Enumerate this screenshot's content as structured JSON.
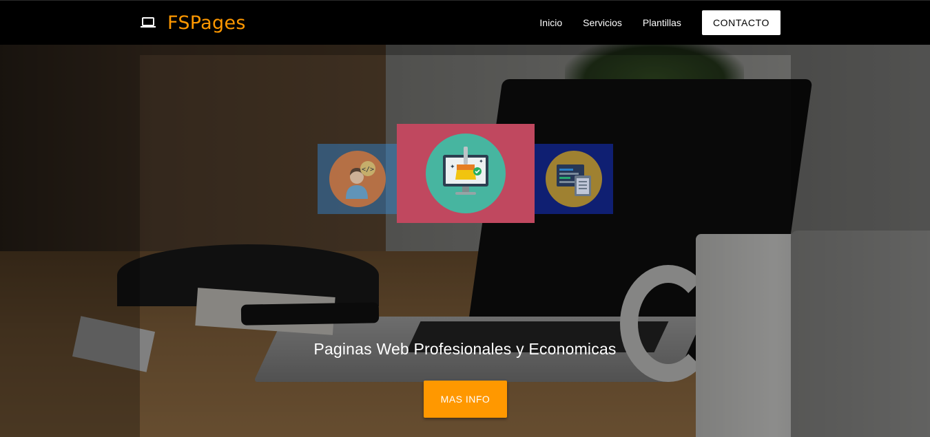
{
  "navbar": {
    "brand_icon": "laptop-icon",
    "brand_name": "FSPages",
    "links": [
      {
        "label": "Inicio"
      },
      {
        "label": "Servicios"
      },
      {
        "label": "Plantillas"
      }
    ],
    "cta_label": "CONTACTO"
  },
  "hero": {
    "title": "Paginas Web Profesionales y Economicas",
    "button_label": "MAS INFO",
    "carousel": [
      {
        "icon": "developer-person-icon",
        "color": "#d5763a"
      },
      {
        "icon": "monitor-cleaning-brush-icon",
        "color": "#47b5a0"
      },
      {
        "icon": "code-clipboard-icon",
        "color": "#c49a22"
      }
    ]
  },
  "colors": {
    "accent": "#ff9800",
    "navbar_bg": "#000000",
    "cta_bg": "#ffffff",
    "slide_center_bg": "#c0485f"
  }
}
